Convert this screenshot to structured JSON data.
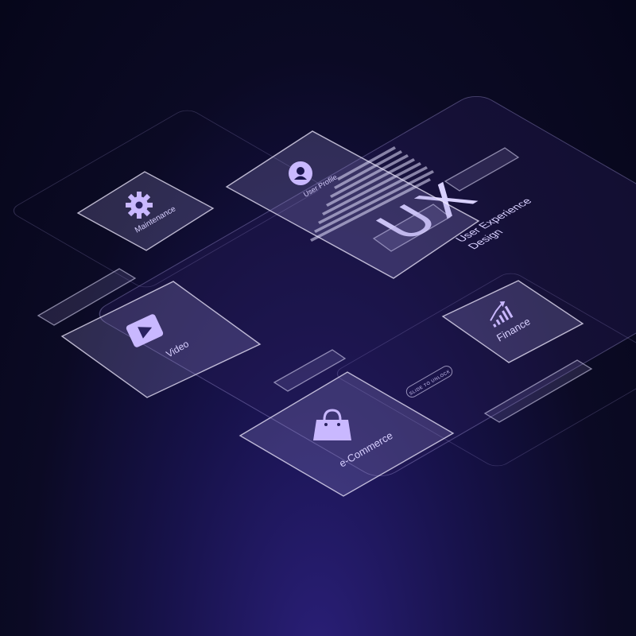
{
  "center": {
    "title": "UX",
    "subtitle_line1": "User Experience",
    "subtitle_line2": "Design",
    "slide_hint": "SLIDE TO UNLOCK"
  },
  "cards": {
    "maintenance": {
      "label": "Maintenance",
      "icon": "gear-icon"
    },
    "user_profile": {
      "label": "User Profile",
      "icon": "user-icon"
    },
    "video": {
      "label": "Video",
      "icon": "play-icon"
    },
    "finance": {
      "label": "Finance",
      "icon": "chart-icon"
    },
    "ecommerce": {
      "label": "e-Commerce",
      "icon": "shopping-bag-icon"
    }
  },
  "colors": {
    "accent": "#c9b8ff",
    "background": "#0b0a24"
  }
}
